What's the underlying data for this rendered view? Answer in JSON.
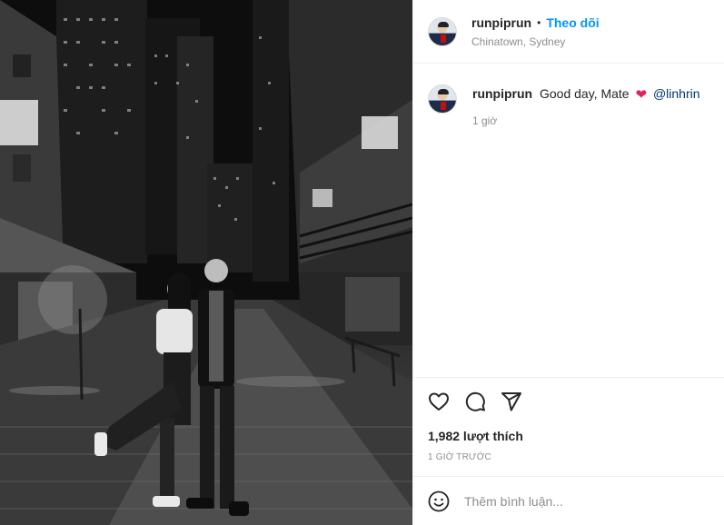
{
  "post": {
    "username": "runpiprun",
    "separator": "•",
    "follow_label": "Theo dõi",
    "location": "Chinatown, Sydney",
    "caption": {
      "username": "runpiprun",
      "text": "Good day, Mate",
      "emoji": "❤",
      "mention": "@linhrin",
      "time": "1 giờ"
    },
    "likes": "1,982 lượt thích",
    "timeago": "1 GIỜ TRƯỚC",
    "comment_placeholder": "Thêm bình luận..."
  },
  "icons": {
    "like": "heart-icon",
    "comment": "comment-icon",
    "share": "send-icon",
    "emoji": "smiley-icon"
  }
}
